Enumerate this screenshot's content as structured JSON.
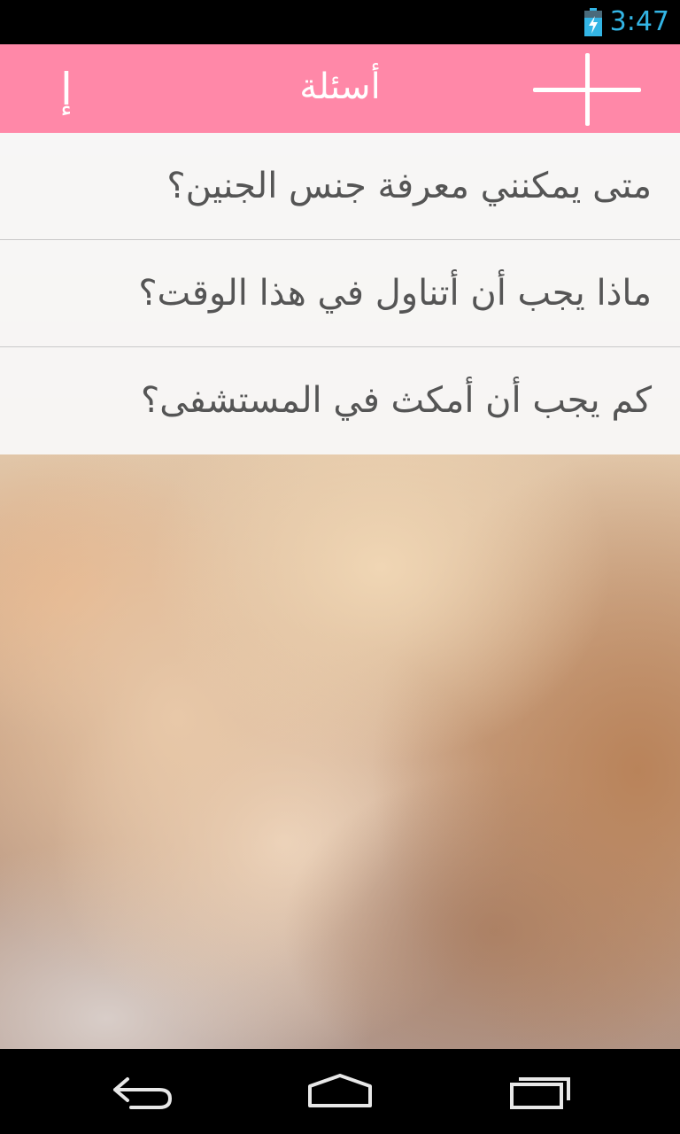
{
  "status_bar": {
    "time": "3:47",
    "time_color": "#33b5e5",
    "battery_icon": "battery-charging-icon"
  },
  "action_bar": {
    "title": "أسئلة",
    "info_label": "إ",
    "add_icon": "plus-icon",
    "background": "#ff88a8"
  },
  "questions": [
    {
      "text": "متى يمكنني معرفة جنس الجنين؟"
    },
    {
      "text": "ماذا يجب أن أتناول في هذا الوقت؟"
    },
    {
      "text": "كم يجب أن أمكث في المستشفى؟"
    }
  ],
  "nav_bar": {
    "back_icon": "back-arrow-icon",
    "home_icon": "home-icon",
    "recents_icon": "recent-apps-icon"
  }
}
